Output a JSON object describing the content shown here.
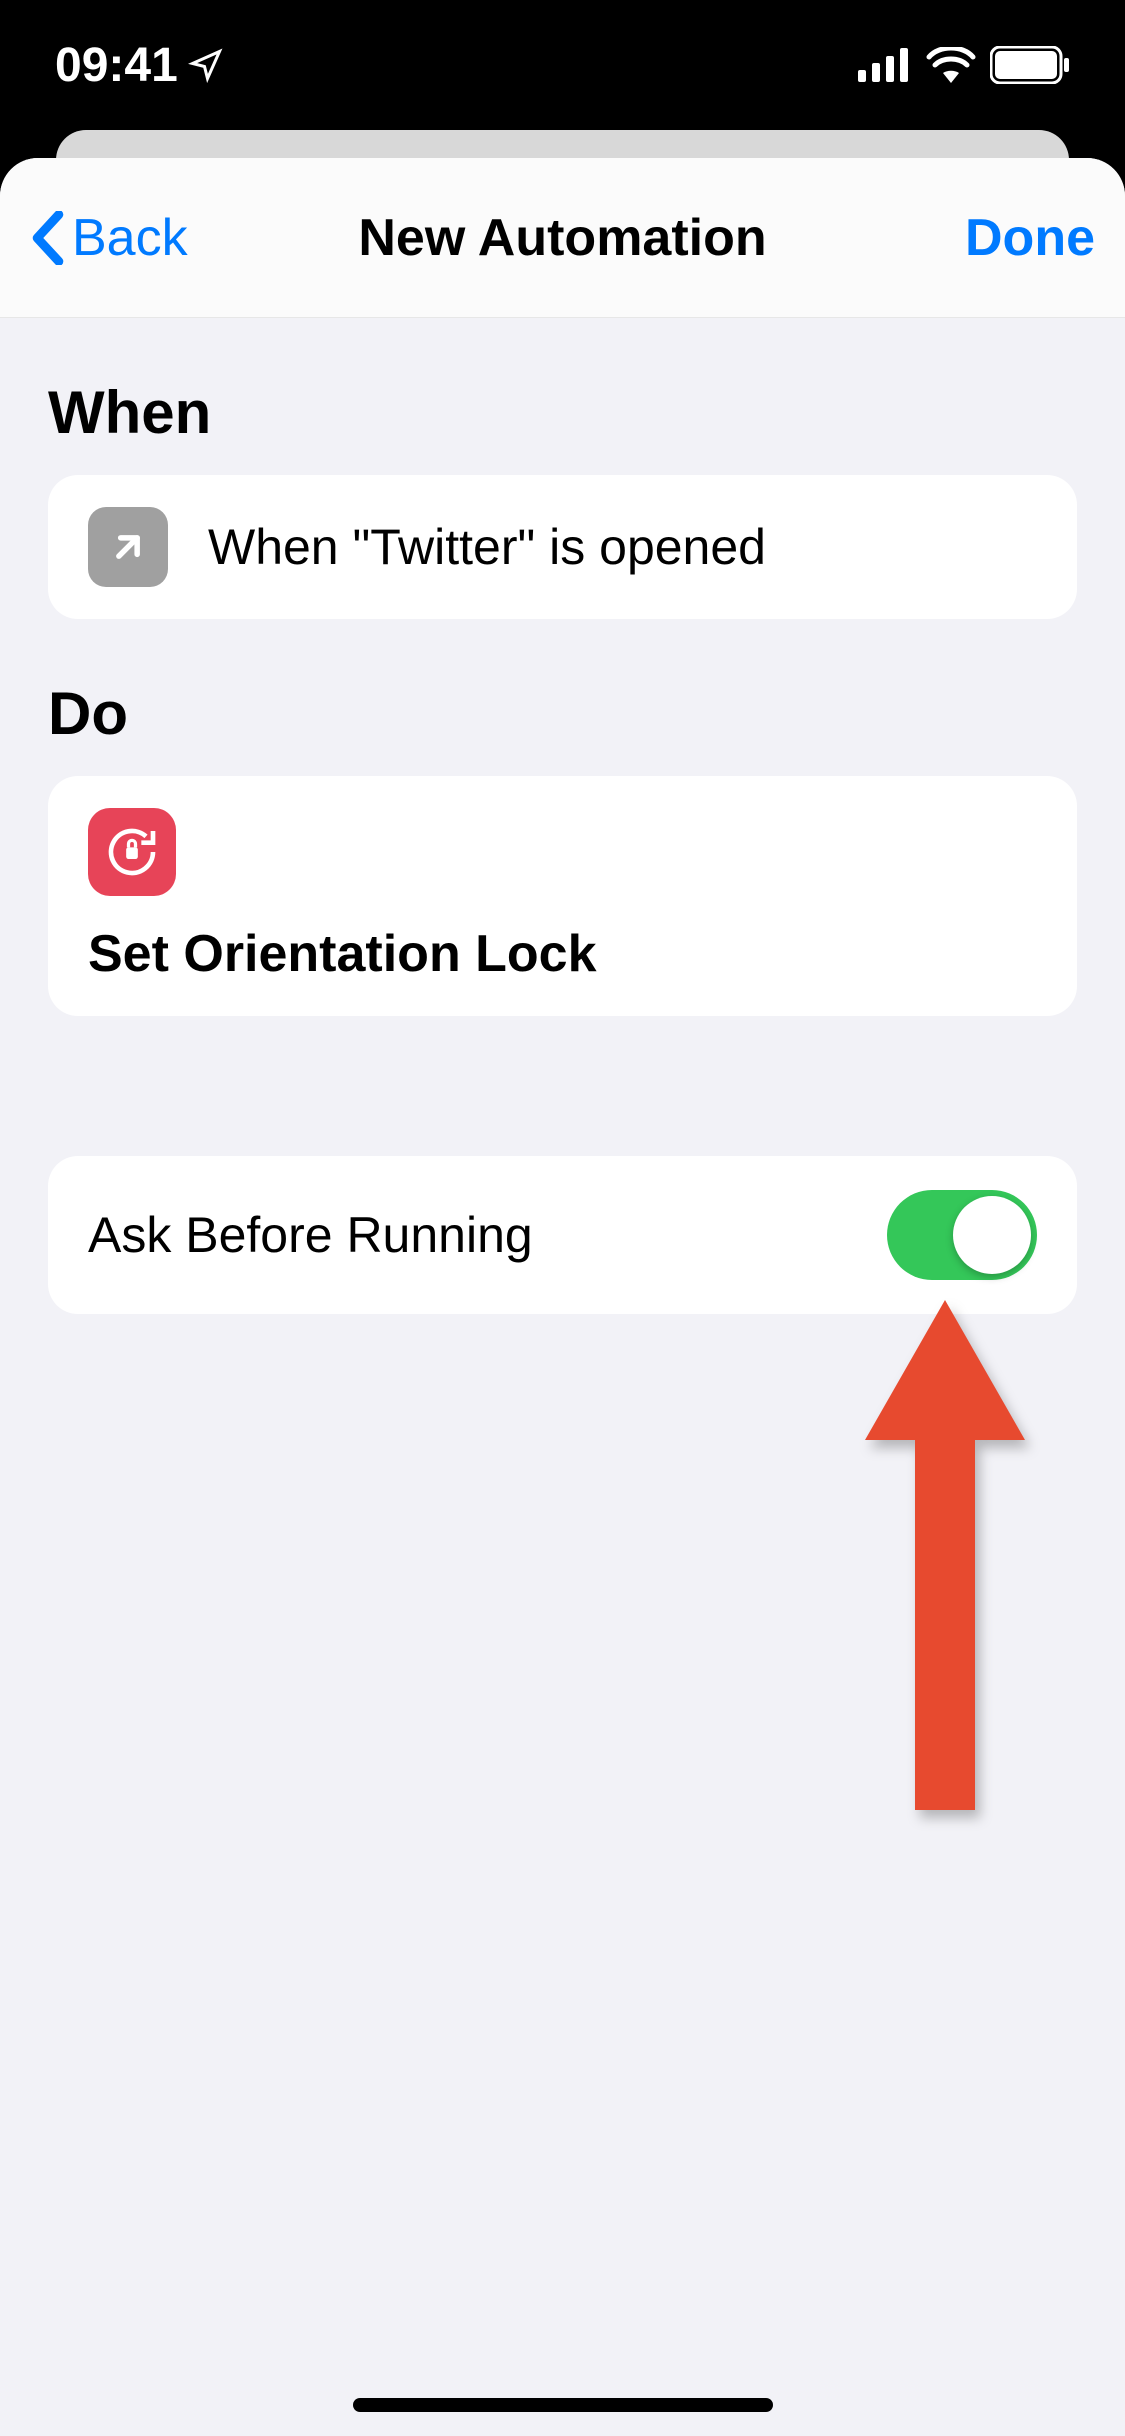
{
  "status": {
    "time": "09:41"
  },
  "nav": {
    "back": "Back",
    "title": "New Automation",
    "done": "Done"
  },
  "sections": {
    "when_header": "When",
    "do_header": "Do"
  },
  "trigger": {
    "text": "When \"Twitter\" is opened"
  },
  "action": {
    "title": "Set Orientation Lock"
  },
  "option": {
    "label": "Ask Before Running",
    "on": true
  },
  "colors": {
    "accent": "#007aff",
    "toggle_on": "#34c759",
    "action_icon": "#e74458",
    "annotation": "#e74a2f"
  }
}
